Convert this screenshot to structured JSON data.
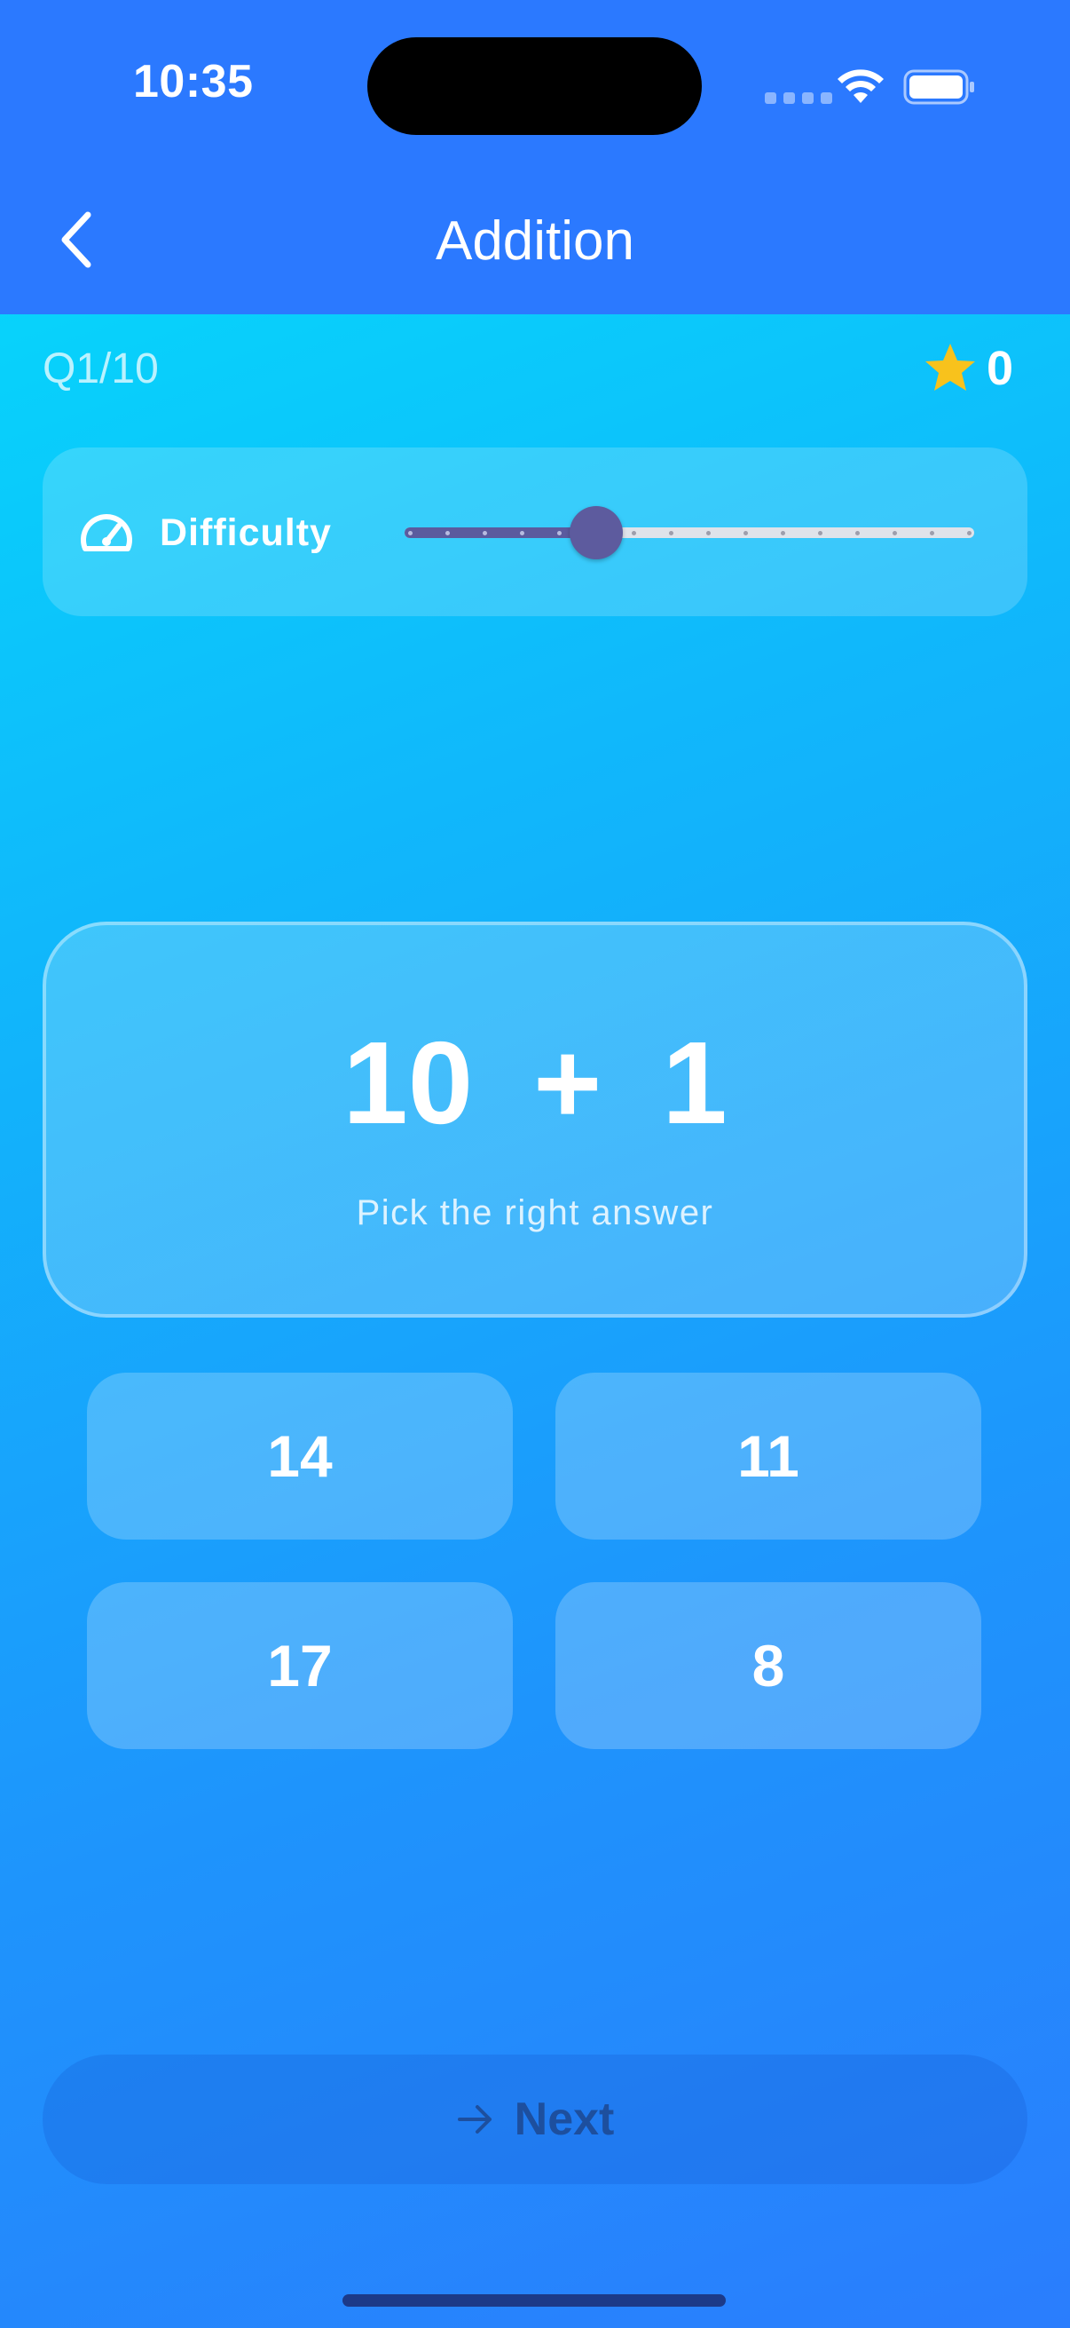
{
  "status_bar": {
    "time": "10:35"
  },
  "nav": {
    "title": "Addition",
    "back_icon": "chevron-left-icon"
  },
  "progress": {
    "label": "Q1/10",
    "score": "0",
    "score_icon": "star-icon"
  },
  "difficulty": {
    "label": "Difficulty",
    "icon": "gauge-icon",
    "level": 5,
    "max": 15
  },
  "question": {
    "left": "10",
    "operator": "+",
    "right": "1",
    "prompt": "Pick the right answer"
  },
  "answers": [
    "14",
    "11",
    "17",
    "8"
  ],
  "next_button": {
    "label": "Next",
    "icon": "arrow-right-icon"
  },
  "colors": {
    "header": "#2b79ff",
    "slider_fill": "#5b5b9e",
    "star": "#f8c21c",
    "next_text": "#1d4f9e"
  }
}
